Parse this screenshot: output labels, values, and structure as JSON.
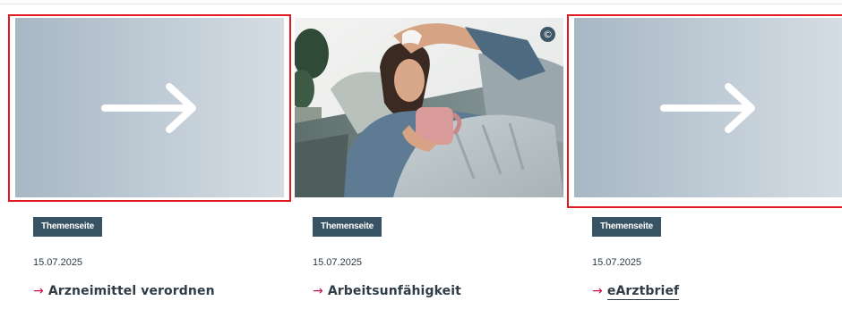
{
  "cards": [
    {
      "image": "placeholder-arrow",
      "badge": "Themenseite",
      "date": "15.07.2025",
      "title": "Arzneimittel verordnen"
    },
    {
      "image": "photo-woman-sick-on-sofa-with-cup",
      "copyright": "©",
      "badge": "Themenseite",
      "date": "15.07.2025",
      "title": "Arbeitsunfähigkeit"
    },
    {
      "image": "placeholder-arrow",
      "badge": "Themenseite",
      "date": "15.07.2025",
      "title": "eArztbrief"
    }
  ],
  "title_arrow": "→",
  "colors": {
    "badge_bg": "#385464",
    "arrow_accent": "#c4124f",
    "highlight": "#e01b24",
    "placeholder": "#b8c5d0"
  }
}
